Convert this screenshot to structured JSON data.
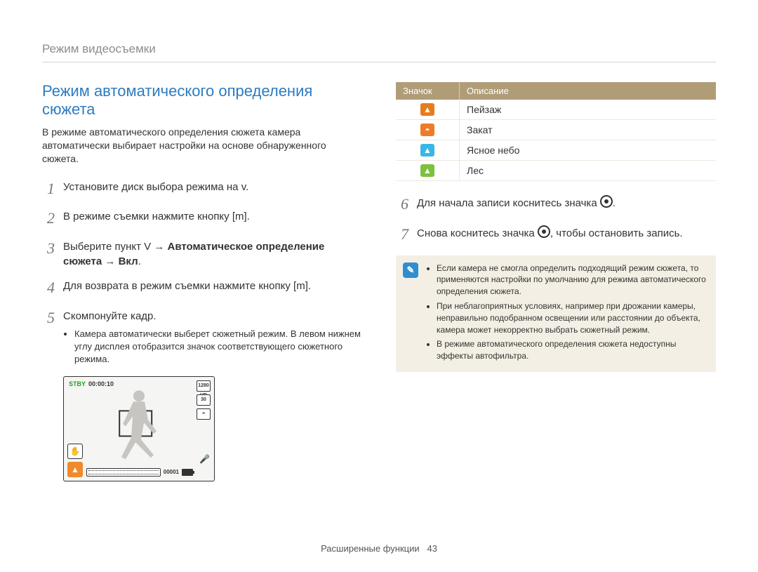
{
  "breadcrumb": "Режим видеосъемки",
  "section_title": "Режим автоматического определения сюжета",
  "intro": "В режиме автоматического определения сюжета камера автоматически выбирает настройки на основе обнаруженного сюжета.",
  "steps_left": {
    "1": {
      "num": "1",
      "text_before": "Установите диск выбора режима на ",
      "marker": "v",
      "text_after": "."
    },
    "2": {
      "num": "2",
      "text_before": "В режиме съемки нажмите кнопку [",
      "marker": "m",
      "text_after": "]."
    },
    "3": {
      "num": "3",
      "text_before": "Выберите пункт ",
      "marker": "V",
      "arrow1": " → ",
      "bold1": "Автоматическое определение сюжета",
      "arrow2": " → ",
      "bold2": "Вкл",
      "text_after": "."
    },
    "4": {
      "num": "4",
      "text_before": "Для возврата в режим съемки нажмите кнопку [",
      "marker": "m",
      "text_after": "]."
    },
    "5": {
      "num": "5",
      "text": "Скомпонуйте кадр.",
      "bullet": "Камера автоматически выберет сюжетный режим. В левом нижнем углу дисплея отобразится значок соответствующего сюжетного режима."
    }
  },
  "camera": {
    "status": "STBY",
    "time": "00:00:10",
    "res": "1280 HD",
    "fps": "30",
    "counter": "00001"
  },
  "icon_table": {
    "head_icon": "Значок",
    "head_desc": "Описание",
    "rows": [
      {
        "icon_class": "mi-landscape",
        "glyph": "▲",
        "label": "Пейзаж"
      },
      {
        "icon_class": "mi-sunset",
        "glyph": "◓",
        "label": "Закат"
      },
      {
        "icon_class": "mi-clearsky",
        "glyph": "▲",
        "label": "Ясное небо"
      },
      {
        "icon_class": "mi-forest",
        "glyph": "▲",
        "label": "Лес"
      }
    ]
  },
  "steps_right": {
    "6": {
      "num": "6",
      "text_before": "Для начала записи коснитесь значка ",
      "text_after": "."
    },
    "7": {
      "num": "7",
      "text_before": "Снова коснитесь значка ",
      "text_after": ", чтобы остановить запись."
    }
  },
  "notes": [
    "Если камера не смогла определить подходящий режим сюжета, то применяются настройки по умолчанию для режима автоматического определения сюжета.",
    "При неблагоприятных условиях, например при дрожании камеры, неправильно подобранном освещении или расстоянии до объекта, камера может некорректно выбрать сюжетный режим.",
    "В режиме автоматического определения сюжета недоступны эффекты автофильтра."
  ],
  "footer": {
    "label": "Расширенные функции",
    "page": "43"
  }
}
